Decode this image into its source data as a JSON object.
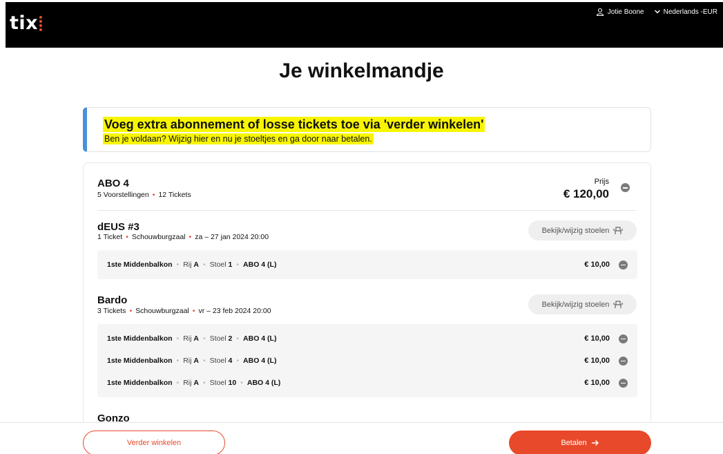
{
  "header": {
    "logo_text": "tix",
    "user_name": "Jotie Boone",
    "locale": "Nederlands -EUR"
  },
  "page_title": "Je winkelmandje",
  "notice": {
    "title": "Voeg extra abonnement of losse tickets toe via 'verder winkelen'",
    "text": "Ben je voldaan? Wijzig hier en nu je stoeltjes en ga door naar betalen."
  },
  "subscription": {
    "name": "ABO 4",
    "performances": "5 Voorstellingen",
    "tickets": "12 Tickets",
    "price_label": "Prijs",
    "price": "€ 120,00"
  },
  "seat_button_label": "Bekijk/wijzig stoelen",
  "events": [
    {
      "name": "dEUS #3",
      "tickets": "1 Ticket",
      "hall": "Schouwburgzaal",
      "date": "za – 27 jan 2024 20:00",
      "rows": [
        {
          "section": "1ste Middenbalkon",
          "row_label": "Rij",
          "row": "A",
          "seat_label": "Stoel",
          "seat": "1",
          "abo": "ABO 4 (L)",
          "price": "€ 10,00"
        }
      ]
    },
    {
      "name": "Bardo",
      "tickets": "3 Tickets",
      "hall": "Schouwburgzaal",
      "date": "vr – 23 feb 2024 20:00",
      "rows": [
        {
          "section": "1ste Middenbalkon",
          "row_label": "Rij",
          "row": "A",
          "seat_label": "Stoel",
          "seat": "2",
          "abo": "ABO 4 (L)",
          "price": "€ 10,00"
        },
        {
          "section": "1ste Middenbalkon",
          "row_label": "Rij",
          "row": "A",
          "seat_label": "Stoel",
          "seat": "4",
          "abo": "ABO 4 (L)",
          "price": "€ 10,00"
        },
        {
          "section": "1ste Middenbalkon",
          "row_label": "Rij",
          "row": "A",
          "seat_label": "Stoel",
          "seat": "10",
          "abo": "ABO 4 (L)",
          "price": "€ 10,00"
        }
      ]
    },
    {
      "name": "Gonzo"
    }
  ],
  "footer": {
    "continue_label": "Verder winkelen",
    "pay_label": "Betalen"
  },
  "colors": {
    "accent": "#e8492b",
    "highlight": "#f8f500",
    "info_border": "#4a90d9"
  }
}
